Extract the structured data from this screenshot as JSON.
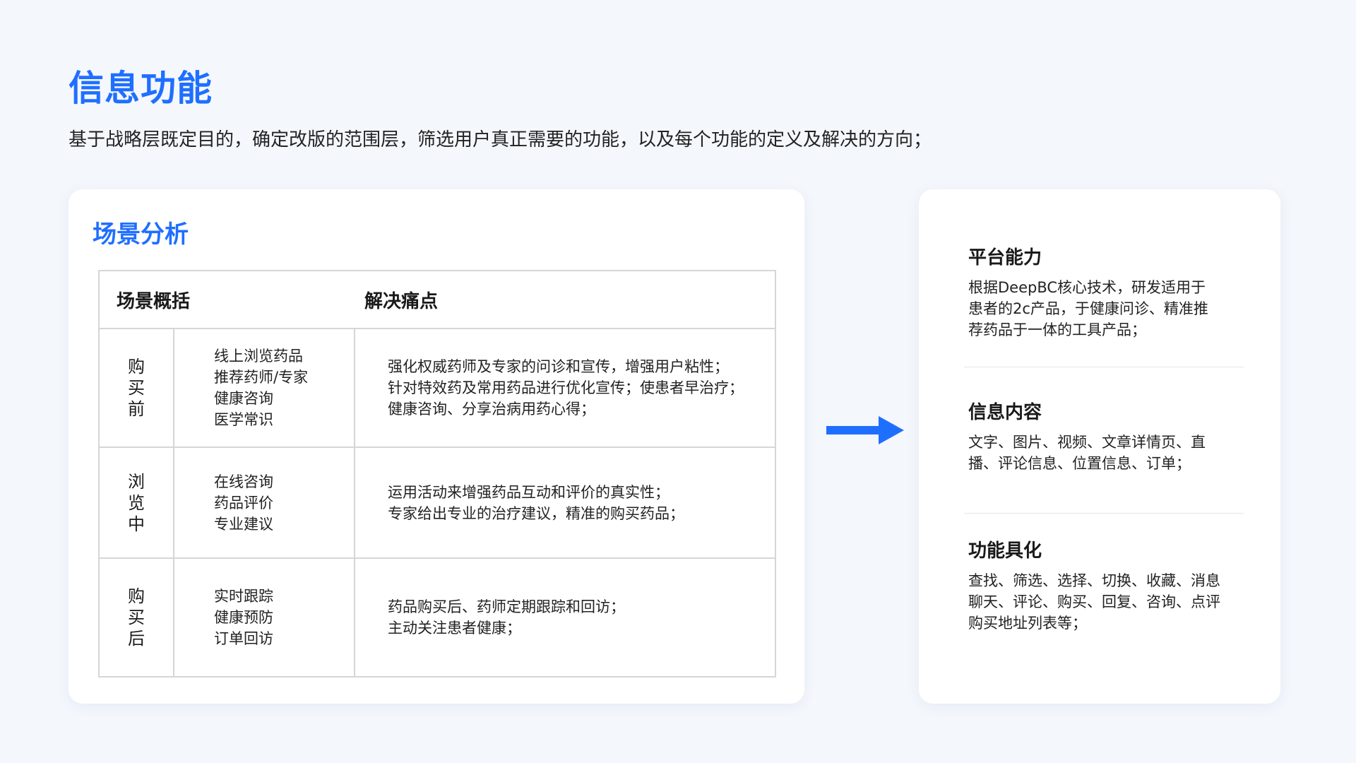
{
  "page": {
    "title": "信息功能",
    "subtitle": "基于战略层既定目的，确定改版的范围层，筛选用户真正需要的功能，以及每个功能的定义及解决的方向；"
  },
  "scene_analysis": {
    "title": "场景分析",
    "headers": {
      "summary": "场景概括",
      "solution": "解决痛点"
    },
    "rows": [
      {
        "stage": "购买前",
        "items": [
          "线上浏览药品",
          "推荐药师/专家",
          "健康咨询",
          "医学常识"
        ],
        "solutions": [
          "强化权威药师及专家的问诊和宣传，增强用户粘性；",
          "针对特效药及常用药品进行优化宣传；使患者早治疗；",
          "健康咨询、分享治病用药心得；"
        ]
      },
      {
        "stage": "浏览中",
        "items": [
          "在线咨询",
          "药品评价",
          "专业建议"
        ],
        "solutions": [
          "运用活动来增强药品互动和评价的真实性；",
          "专家给出专业的治疗建议，精准的购买药品；"
        ]
      },
      {
        "stage": "购买后",
        "items": [
          "实时跟踪",
          "健康预防",
          "订单回访"
        ],
        "solutions": [
          "药品购买后、药师定期跟踪和回访；",
          "主动关注患者健康；"
        ]
      }
    ]
  },
  "features": [
    {
      "title": "平台能力",
      "lines": [
        "根据DeepBC核心技术，研发适用于",
        "患者的2c产品，于健康问诊、精准推",
        "荐药品于一体的工具产品；"
      ]
    },
    {
      "title": "信息内容",
      "lines": [
        "文字、图片、视频、文章详情页、直",
        "播、评论信息、位置信息、订单；"
      ]
    },
    {
      "title": "功能具化",
      "lines": [
        "查找、筛选、选择、切换、收藏、消息",
        "聊天、评论、购买、回复、咨询、点评",
        "购买地址列表等；"
      ]
    }
  ],
  "colors": {
    "accent": "#1f6fff",
    "background": "#f4f7fc",
    "card": "#ffffff",
    "border": "#d6d6d6"
  },
  "icons": {
    "arrow": "arrow-right-icon"
  }
}
